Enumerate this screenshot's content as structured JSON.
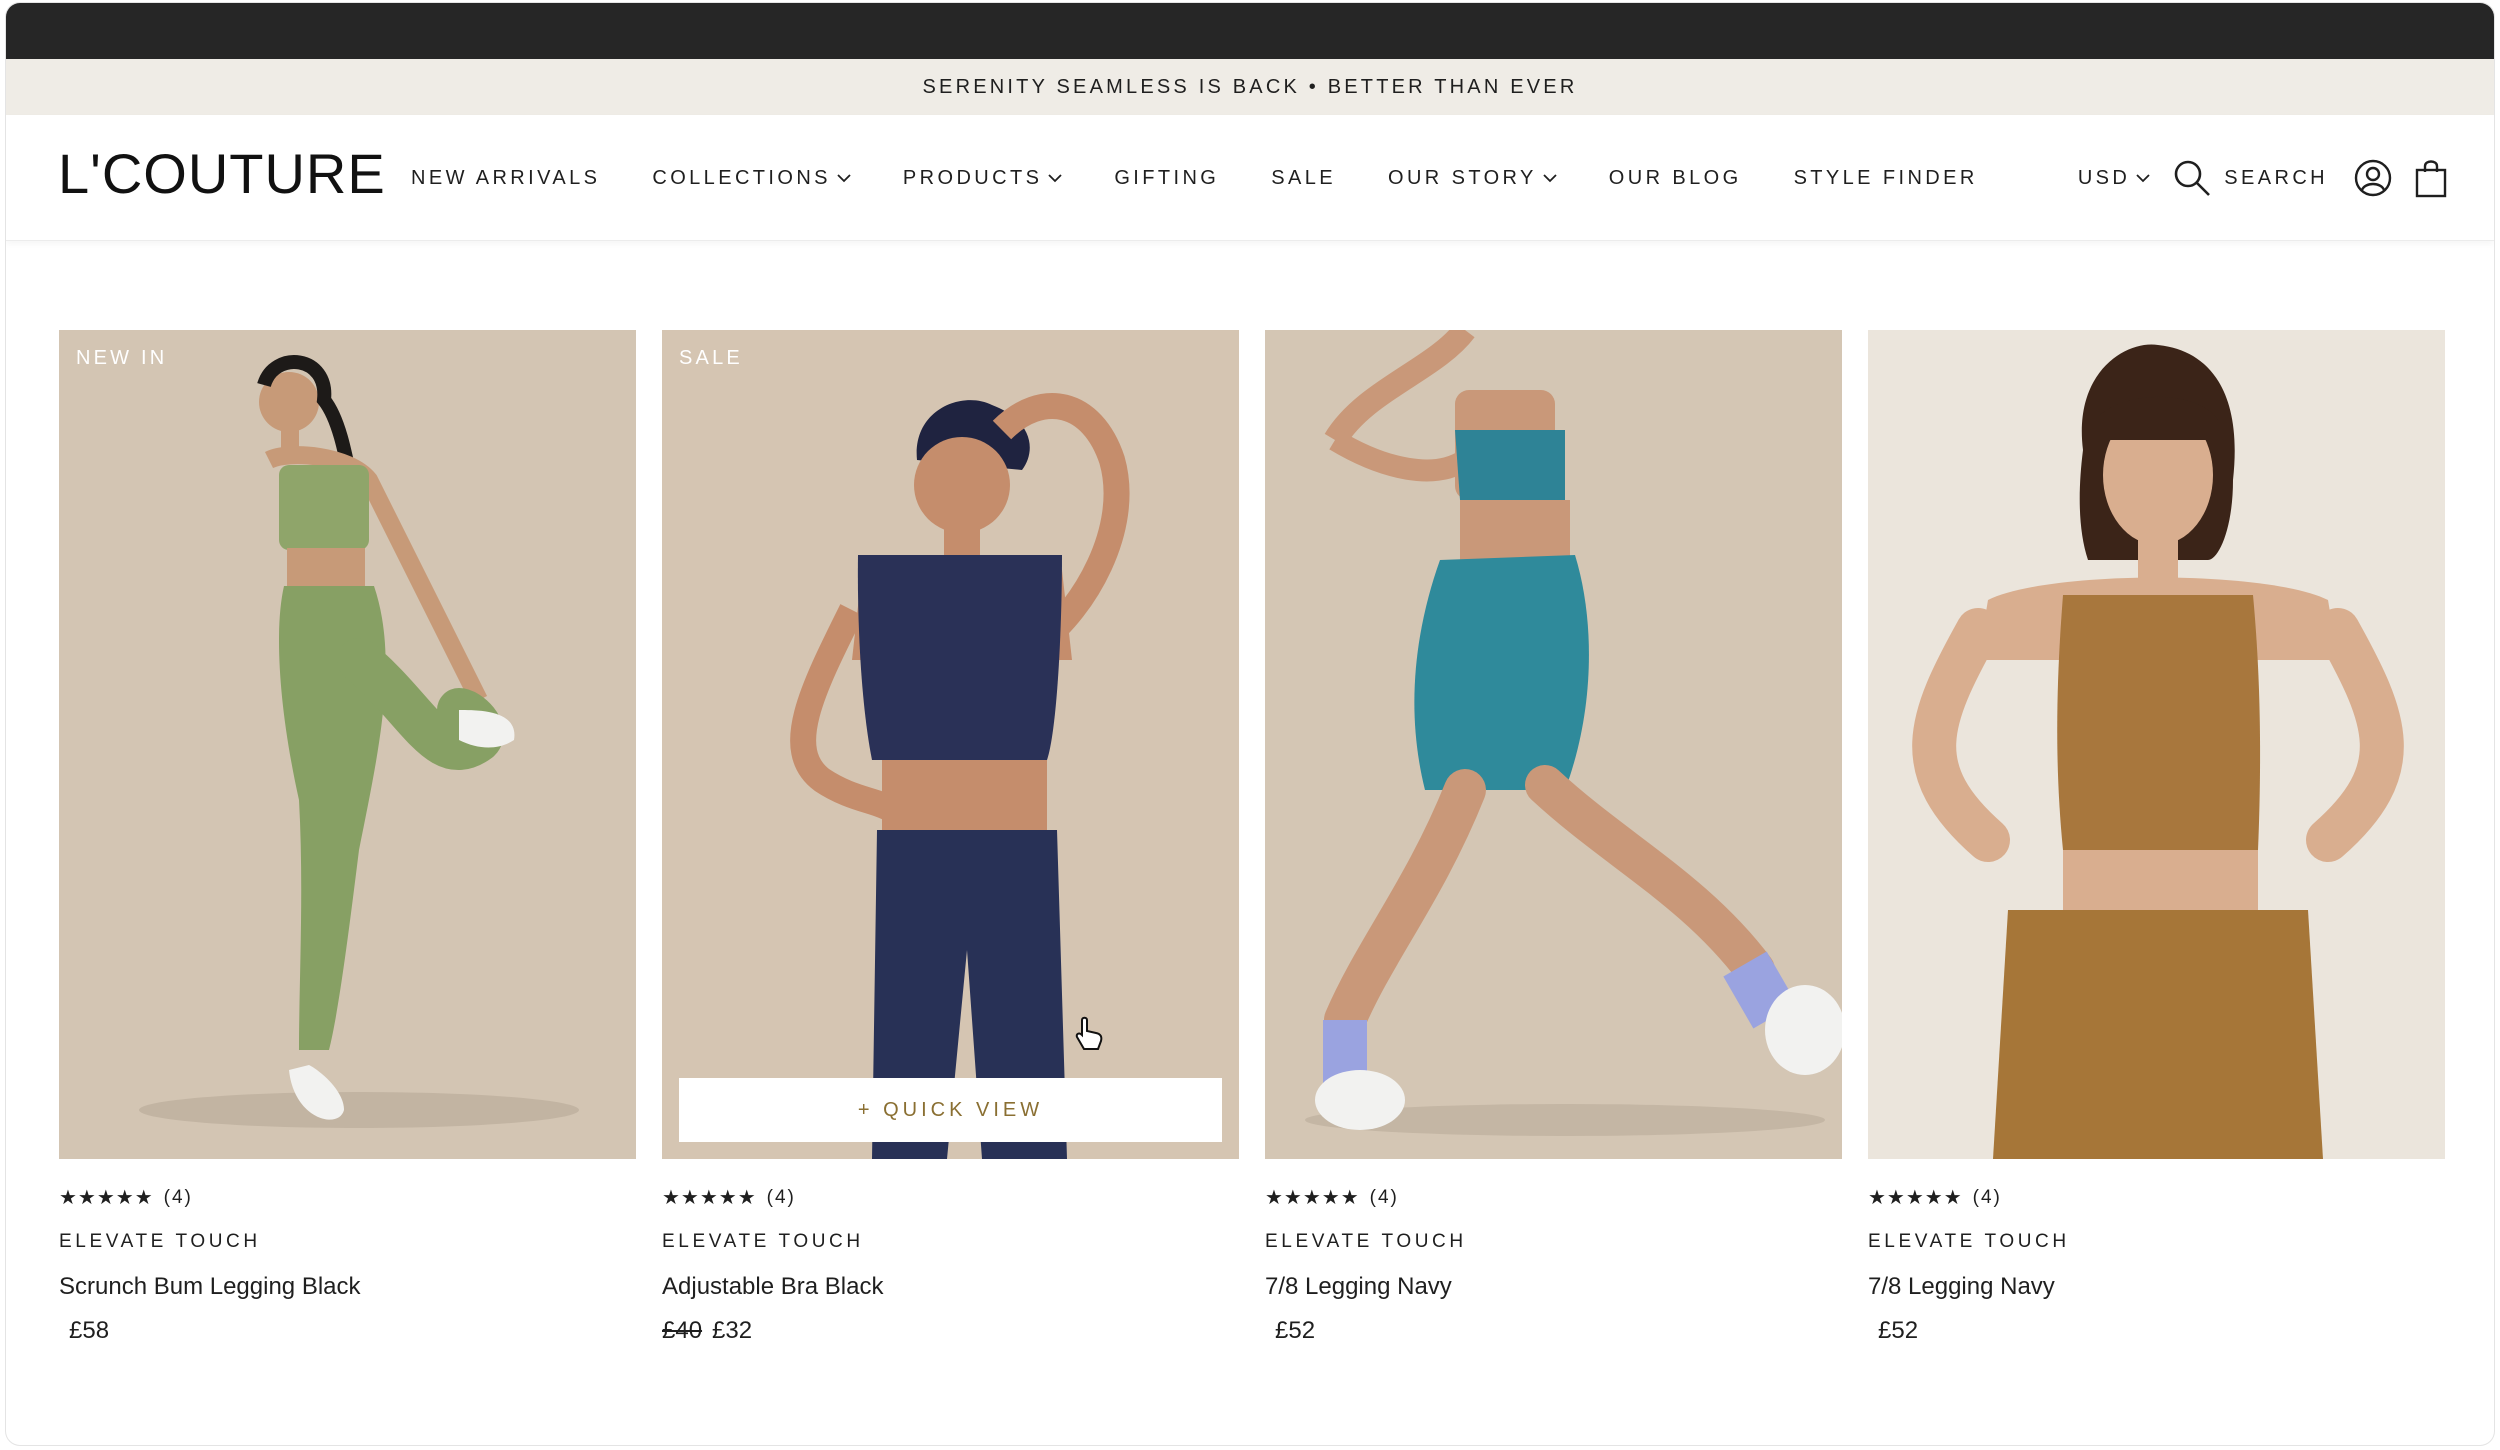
{
  "announcement": "SERENITY SEAMLESS IS BACK • BETTER THAN EVER",
  "logo": "L'COUTURE",
  "nav": [
    {
      "label": "NEW ARRIVALS",
      "dropdown": false
    },
    {
      "label": "COLLECTIONS",
      "dropdown": true
    },
    {
      "label": "PRODUCTS",
      "dropdown": true
    },
    {
      "label": "GIFTING",
      "dropdown": false
    },
    {
      "label": "SALE",
      "dropdown": false
    },
    {
      "label": "OUR STORY",
      "dropdown": true
    },
    {
      "label": "OUR BLOG",
      "dropdown": false
    },
    {
      "label": "STYLE FINDER",
      "dropdown": false
    }
  ],
  "tools": {
    "currency": "USD",
    "search_label": "SEARCH",
    "icons": [
      "chevron-down-icon",
      "search-icon",
      "account-icon",
      "bag-icon"
    ]
  },
  "products": [
    {
      "badge": "NEW IN",
      "stars": "★★★★★",
      "reviews": "(4)",
      "brand": "ELEVATE TOUCH",
      "name": "Scrunch Bum Legging Black",
      "price": "£58",
      "old_price": "",
      "colors": {
        "bg": "#d4c7b6",
        "top": "#8fa56a",
        "bottom": "#87a064",
        "skin": "#c79a78"
      }
    },
    {
      "badge": "SALE",
      "stars": "★★★★★",
      "reviews": "(4)",
      "brand": "ELEVATE TOUCH",
      "name": "Adjustable Bra Black",
      "price": "£32",
      "old_price": "£40",
      "quick_view": "+ QUICK VIEW",
      "colors": {
        "bg": "#d6c6b5",
        "top": "#2a3157",
        "bottom": "#283156",
        "skin": "#c58d6c"
      }
    },
    {
      "badge": "",
      "stars": "★★★★★",
      "reviews": "(4)",
      "brand": "ELEVATE TOUCH",
      "name": "7/8 Legging Navy",
      "price": "£52",
      "old_price": "",
      "colors": {
        "bg": "#d5c7b5",
        "top": "#2e8396",
        "bottom": "#2f8a9b",
        "skin": "#c99879"
      }
    },
    {
      "badge": "",
      "stars": "★★★★★",
      "reviews": "(4)",
      "brand": "ELEVATE TOUCH",
      "name": "7/8 Legging Navy",
      "price": "£52",
      "old_price": "",
      "colors": {
        "bg": "#ece6dd",
        "top": "#a8773d",
        "bottom": "#a67638",
        "skin": "#d9ae8f"
      }
    }
  ]
}
